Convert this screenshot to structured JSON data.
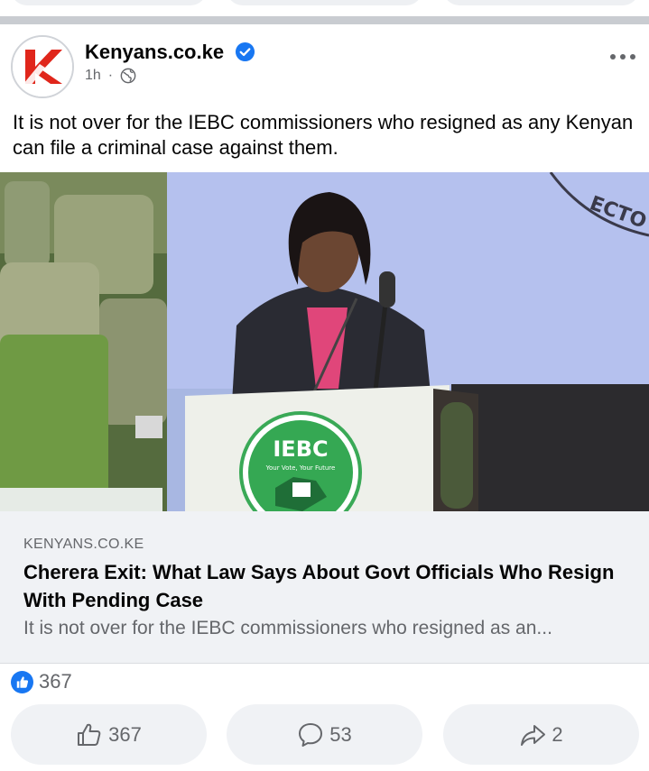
{
  "post": {
    "page_name": "Kenyans.co.ke",
    "time": "1h",
    "separator_dot": "·",
    "caption": "It is not over for the IEBC commissioners who resigned as any Kenyan can file a criminal case against them."
  },
  "photo": {
    "podium_logo_text": "IEBC",
    "podium_slogan": "Your Vote, Your Future",
    "backdrop_text": "ECTO"
  },
  "link_preview": {
    "domain": "KENYANS.CO.KE",
    "title": "Cherera Exit: What Law Says About Govt Officials Who Resign With Pending Case",
    "description": "It is not over for the IEBC commissioners who resigned as an..."
  },
  "reactions": {
    "count": "367"
  },
  "actions": {
    "like_count": "367",
    "comment_count": "53",
    "share_count": "2"
  },
  "icons": {
    "verified": "verified-badge-icon",
    "globe": "globe-icon",
    "more": "more-options-icon",
    "like": "thumbs-up-icon",
    "comment": "comment-icon",
    "share": "share-icon"
  },
  "colors": {
    "brand_blue": "#1877f2",
    "logo_red": "#e0261b",
    "secondary_text": "#65676b",
    "iebc_green": "#2fa84f"
  }
}
